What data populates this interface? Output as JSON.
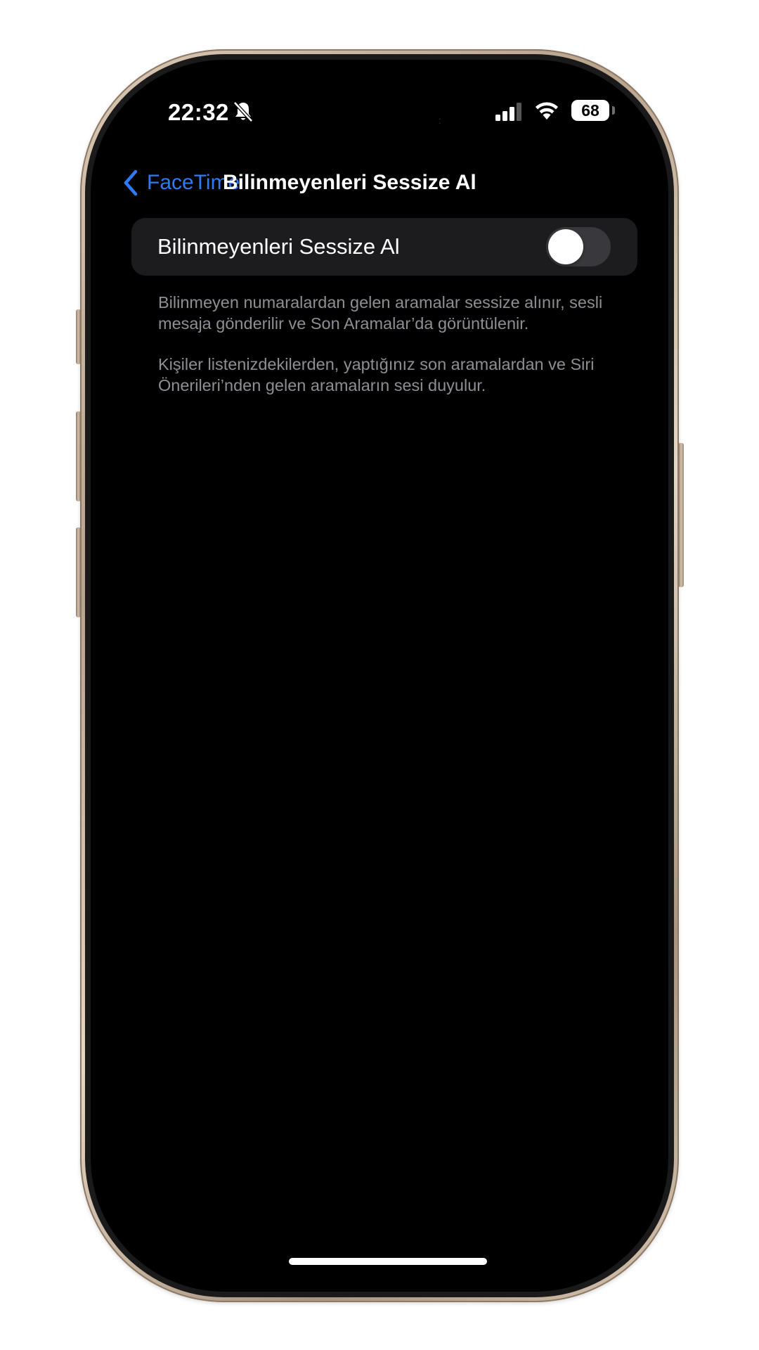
{
  "status_bar": {
    "time": "22:32",
    "bell_icon": "bell-slash-icon",
    "signal_icon": "cellular-signal-icon",
    "wifi_icon": "wifi-icon",
    "battery": "68"
  },
  "nav": {
    "back_label": "FaceTime",
    "back_icon": "chevron-left-icon",
    "title": "Bilinmeyenleri Sessize Al"
  },
  "settings": {
    "toggle_row": {
      "label": "Bilinmeyenleri Sessize Al",
      "enabled": false
    },
    "footnote_1": "Bilinmeyen numaralardan gelen aramalar sessize alınır, sesli mesaja gönderilir ve Son Aramalar’da görüntülenir.",
    "footnote_2": "Kişiler listenizdekilerden, yaptığınız son aramalardan ve Siri Önerileri’nden gelen aramaların sesi duyulur."
  },
  "colors": {
    "accent": "#2f7bf5",
    "background": "#000000",
    "group_background": "#1c1c1e",
    "footnote_text": "#8e8e93",
    "toggle_off": "#39393d"
  }
}
